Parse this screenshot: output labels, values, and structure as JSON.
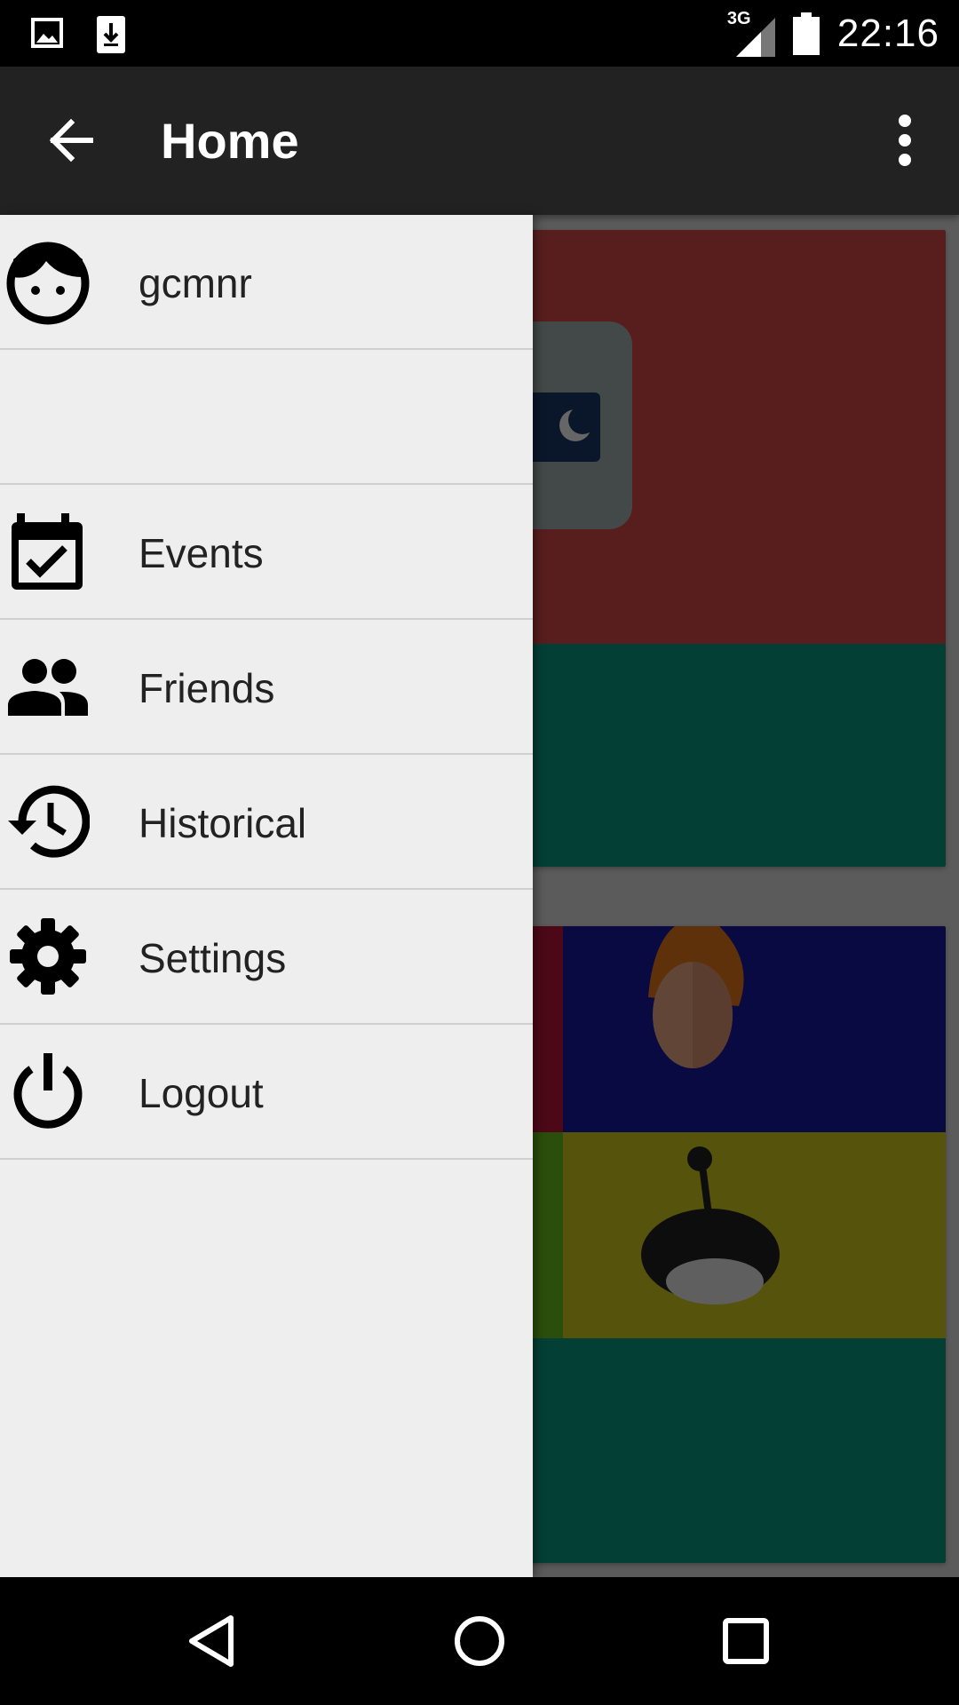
{
  "status_bar": {
    "icons": [
      "image-icon",
      "download-icon",
      "network-signal-icon",
      "battery-icon"
    ],
    "network_label": "3G",
    "time": "22:16"
  },
  "app_bar": {
    "back_icon": "arrow-left-icon",
    "title": "Home",
    "overflow_icon": "more-vert-icon"
  },
  "drawer": {
    "profile": {
      "icon": "face-icon",
      "username": "gcmnr"
    },
    "items": [
      {
        "label": "Events",
        "icon": "calendar-check-icon"
      },
      {
        "label": "Friends",
        "icon": "people-icon"
      },
      {
        "label": "Historical",
        "icon": "history-icon"
      },
      {
        "label": "Settings",
        "icon": "gear-icon"
      },
      {
        "label": "Logout",
        "icon": "power-icon"
      }
    ]
  },
  "background_cards": {
    "card1_colors": [
      "#dd4b4b",
      "#0b9e86"
    ],
    "card2_colors": [
      "#c0163e",
      "#1b1aa5",
      "#6ac21e",
      "#d8cf1e",
      "#0b9e86"
    ]
  },
  "nav_bar": {
    "icons": [
      "nav-back-icon",
      "nav-home-icon",
      "nav-recents-icon"
    ]
  },
  "colors": {
    "app_bar": "#222222",
    "drawer_bg": "#eeeeee",
    "divider": "#cfcfcf"
  }
}
